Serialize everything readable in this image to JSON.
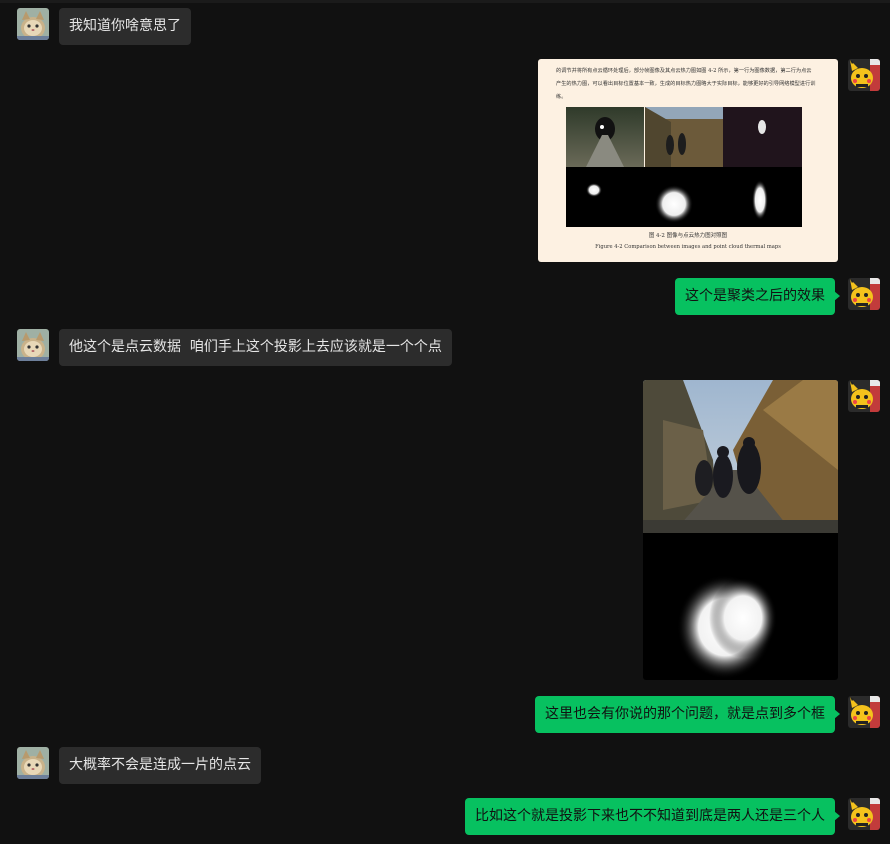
{
  "messages": [
    {
      "side": "left",
      "type": "text",
      "text": "我知道你啥意思了"
    },
    {
      "side": "right",
      "type": "image",
      "image": "paper-figure-screenshot",
      "paper_text": "的调节并将所有点云循环处理后，部分帧图像及其点云热力图如图 4-2 所示，第一行为图像数据，第二行为点云产生的热力图，可以看出目标位置基本一致，生成的目标热力图略大于实际目标，能够更好的引导网络模型进行训练。",
      "caption_cn": "图 4-2 图像与点云热力图对照图",
      "caption_en": "Figure 4-2 Comparison between images and point cloud thermal maps"
    },
    {
      "side": "right",
      "type": "text",
      "text": "这个是聚类之后的效果"
    },
    {
      "side": "left",
      "type": "text",
      "text": "他这个是点云数据  咱们手上这个投影上去应该就是一个个点"
    },
    {
      "side": "right",
      "type": "image",
      "image": "photo-with-heatmap"
    },
    {
      "side": "right",
      "type": "text",
      "text": "这里也会有你说的那个问题，就是点到多个框"
    },
    {
      "side": "left",
      "type": "text",
      "text": "大概率不会是连成一片的点云"
    },
    {
      "side": "right",
      "type": "text",
      "text": "比如这个就是投影下来也不不知道到底是两人还是三个人"
    }
  ],
  "avatars": {
    "left": "cat-avatar",
    "right": "pikachu-avatar"
  },
  "colors": {
    "background": "#111111",
    "bubble_left": "#2c2c2c",
    "bubble_right": "#07c160"
  }
}
